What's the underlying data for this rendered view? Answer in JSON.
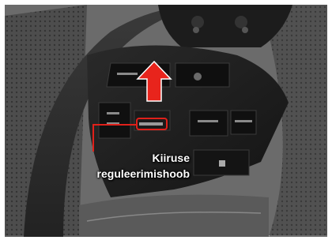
{
  "callout": {
    "line1": "Kiiruse",
    "line2": "reguleerimishoob"
  },
  "colors": {
    "highlight": "#e0201a",
    "arrow": "#e8241c",
    "label_text": "#ffffff"
  },
  "icons": {
    "arrow": "up-arrow-icon"
  }
}
